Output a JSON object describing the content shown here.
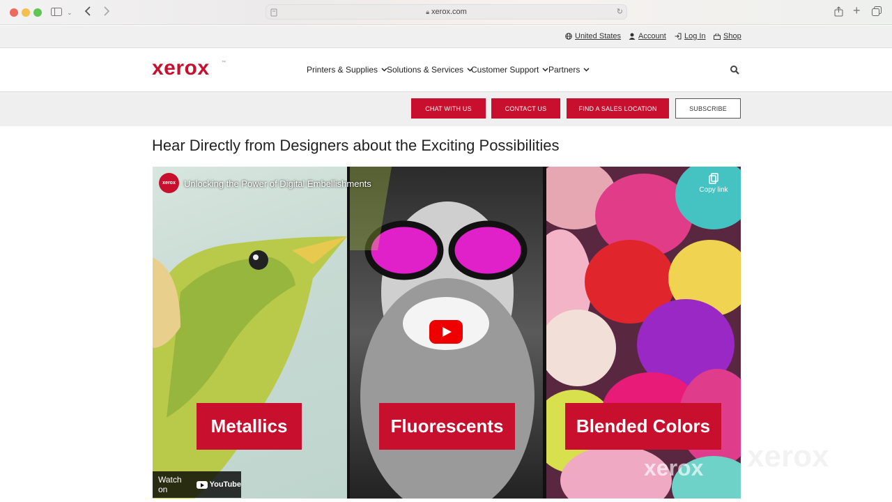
{
  "browser": {
    "url": "xerox.com"
  },
  "utility": {
    "country": "United States",
    "account": "Account",
    "login": "Log In",
    "shop": "Shop"
  },
  "brand": {
    "logo": "xerox",
    "tm": "™"
  },
  "menu": [
    {
      "label": "Printers & Supplies"
    },
    {
      "label": "Solutions & Services"
    },
    {
      "label": "Customer Support"
    },
    {
      "label": "Partners"
    }
  ],
  "actions": {
    "chat": "CHAT WITH US",
    "contact": "CONTACT US",
    "find": "FIND A SALES LOCATION",
    "subscribe": "SUBSCRIBE"
  },
  "page": {
    "heading": "Hear Directly from Designers about the Exciting Possibilities"
  },
  "video": {
    "title": "Unlocking the Power of Digital Embellishments",
    "channel": "xerox",
    "copy_link": "Copy link",
    "watch_on": "Watch on",
    "youtube": "YouTube",
    "panels": [
      {
        "label": "Metallics"
      },
      {
        "label": "Fluorescents"
      },
      {
        "label": "Blended Colors"
      }
    ],
    "watermark": "xerox"
  },
  "colors": {
    "brand": "#c8102e"
  }
}
